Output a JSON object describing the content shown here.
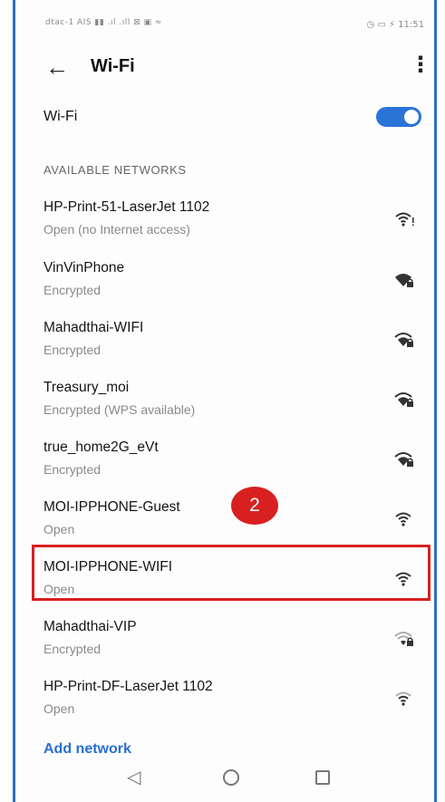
{
  "status_bar": {
    "left_text": "dtac-1 AIS ▮▮ .ıl .ıll ⊠ ▣ ≈",
    "right_text": "◷ ▭ ⚡ 11:51"
  },
  "header": {
    "title": "Wi-Fi",
    "back_icon": "arrow-left-icon",
    "more_icon": "more-vertical-icon"
  },
  "wifi_toggle": {
    "label": "Wi-Fi",
    "enabled": true,
    "accent_color": "#2a74d8"
  },
  "section": {
    "title": "AVAILABLE NETWORKS"
  },
  "networks": [
    {
      "name": "HP-Print-51-LaserJet 1102",
      "status": "Open (no Internet access)",
      "secured": false
    },
    {
      "name": "VinVinPhone",
      "status": "Encrypted",
      "secured": true
    },
    {
      "name": "Mahadthai-WIFI",
      "status": "Encrypted",
      "secured": true
    },
    {
      "name": "Treasury_moi",
      "status": "Encrypted (WPS available)",
      "secured": true
    },
    {
      "name": "true_home2G_eVt",
      "status": "Encrypted",
      "secured": true
    },
    {
      "name": "MOI-IPPHONE-Guest",
      "status": "Open",
      "secured": false
    },
    {
      "name": "MOI-IPPHONE-WIFI",
      "status": "Open",
      "secured": false
    },
    {
      "name": "Mahadthai-VIP",
      "status": "Encrypted",
      "secured": true
    },
    {
      "name": "HP-Print-DF-LaserJet 1102",
      "status": "Open",
      "secured": false
    }
  ],
  "annotation": {
    "badge_text": "2",
    "highlight_color": "#d81f1f"
  },
  "actions": {
    "add_network": "Add network"
  },
  "nav_bar": {
    "back": "◁",
    "home": "home-circle-icon",
    "recents": "recents-square-icon"
  }
}
